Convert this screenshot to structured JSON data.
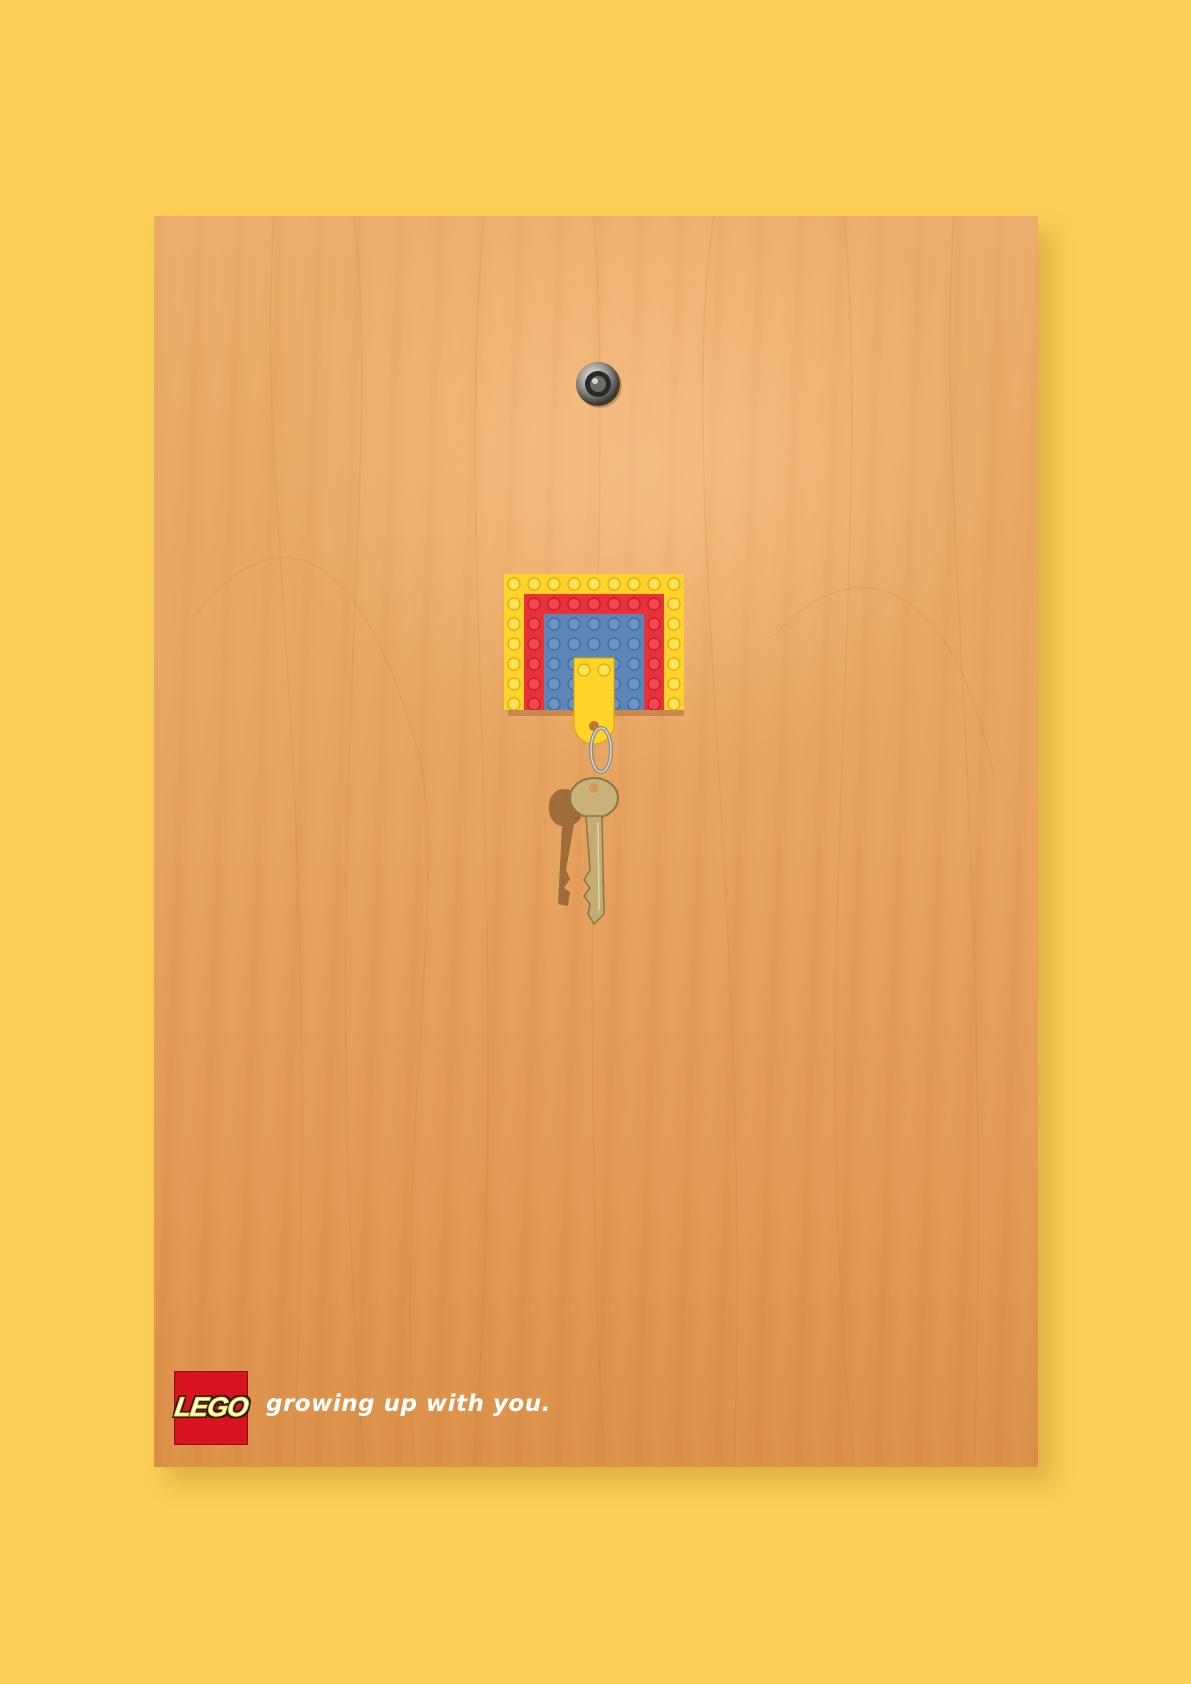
{
  "brand": {
    "logo_text": "LEGO",
    "tagline": "growing up with you."
  },
  "colors": {
    "background": "#FBCF55",
    "wood": "#E8A461",
    "brick_yellow": "#FFD32A",
    "brick_red": "#E8313A",
    "brick_blue": "#5C86B8",
    "logo_red": "#D7141E"
  },
  "icons": {
    "peephole": "door-peephole-icon",
    "key_holder": "lego-key-holder-icon",
    "key": "key-icon"
  }
}
